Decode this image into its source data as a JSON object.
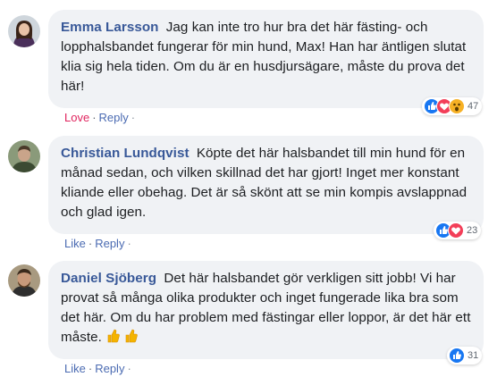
{
  "comments": [
    {
      "author": "Emma Larsson",
      "text": "Jag kan inte tro hur bra det här fästing- och lopphalsbandet fungerar för min hund, Max! Han har äntligen slutat klia sig hela tiden. Om du är en husdjursägare, måste du prova det här!",
      "actions": {
        "primary": "Love",
        "separator": "·",
        "reply": "Reply",
        "dot": "·"
      },
      "reactions": {
        "icons": [
          "like-icon",
          "love-icon",
          "wow-icon"
        ],
        "count": "47"
      }
    },
    {
      "author": "Christian Lundqvist",
      "text": "Köpte det här halsbandet till min hund för en månad sedan, och vilken skillnad det har gjort! Inget mer konstant kliande eller obehag. Det är så skönt att se min kompis avslappnad och glad igen.",
      "actions": {
        "primary": "Like",
        "separator": "·",
        "reply": "Reply",
        "dot": "·"
      },
      "reactions": {
        "icons": [
          "like-icon",
          "love-icon"
        ],
        "count": "23"
      }
    },
    {
      "author": "Daniel Sjöberg",
      "text": "Det här halsbandet gör verkligen sitt jobb! Vi har provat så många olika produkter och inget fungerade lika bra som det här. Om du har problem med fästingar eller loppor, är det här ett måste.",
      "emoji": [
        "thumbs-up-emoji",
        "thumbs-up-emoji"
      ],
      "actions": {
        "primary": "Like",
        "separator": "·",
        "reply": "Reply",
        "dot": "·"
      },
      "reactions": {
        "icons": [
          "like-icon"
        ],
        "count": "31"
      }
    }
  ],
  "colors": {
    "bubble": "#f0f2f5",
    "author": "#385898",
    "love_action": "#e0245e",
    "like_blue": "#1877f2",
    "love_red": "#f33e58",
    "wow_yellow": "#f7b125"
  }
}
